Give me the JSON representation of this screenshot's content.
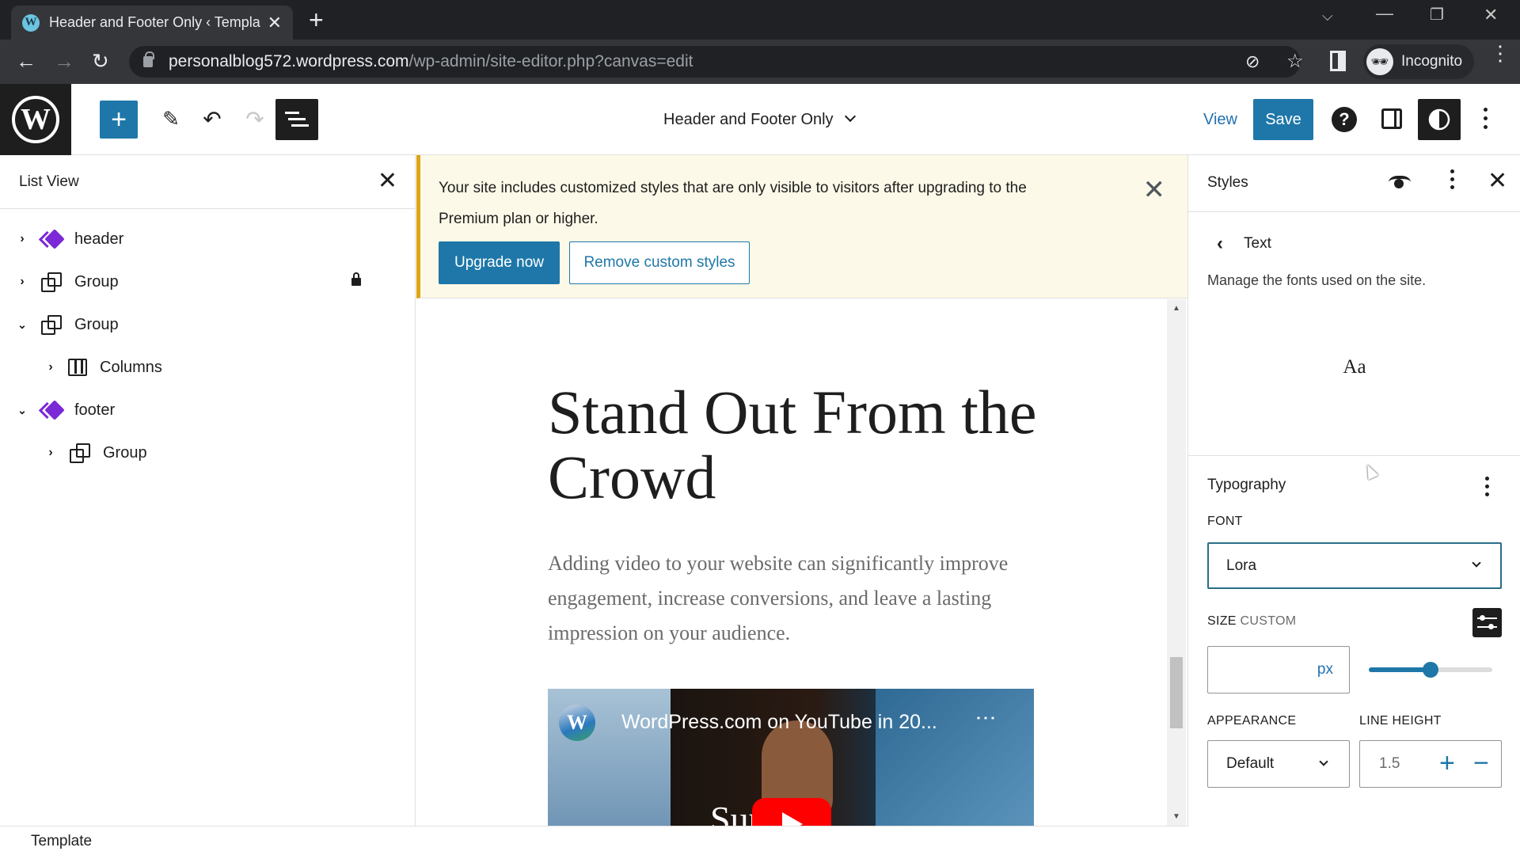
{
  "browser": {
    "tab_title": "Header and Footer Only ‹ Templa",
    "url_host": "personalblog572.wordpress.com",
    "url_path": "/wp-admin/site-editor.php?canvas=edit",
    "profile_label": "Incognito"
  },
  "toolbar": {
    "document_title": "Header and Footer Only",
    "view_label": "View",
    "save_label": "Save"
  },
  "list_view": {
    "title": "List View",
    "items": [
      {
        "label": "header",
        "icon": "template-part-icon",
        "expanded": false,
        "level": 0,
        "locked": false
      },
      {
        "label": "Group",
        "icon": "group-icon",
        "expanded": false,
        "level": 0,
        "locked": true
      },
      {
        "label": "Group",
        "icon": "group-icon",
        "expanded": true,
        "level": 0,
        "locked": false
      },
      {
        "label": "Columns",
        "icon": "columns-icon",
        "expanded": false,
        "level": 1,
        "locked": false
      },
      {
        "label": "footer",
        "icon": "template-part-icon",
        "expanded": true,
        "level": 0,
        "locked": false
      },
      {
        "label": "Group",
        "icon": "group-icon",
        "expanded": false,
        "level": 1,
        "locked": false
      }
    ]
  },
  "notice": {
    "message": "Your site includes customized styles that are only visible to visitors after upgrading to the Premium plan or higher.",
    "upgrade_label": "Upgrade now",
    "remove_label": "Remove custom styles",
    "accent_color": "#dba617"
  },
  "canvas": {
    "heading": "Stand Out From the Crowd",
    "paragraph": "Adding video to your website can significantly improve engagement, increase conversions, and leave a lasting impression on your audience.",
    "video_title": "WordPress.com on YouTube in 20...",
    "video_overlay_text": "Support"
  },
  "status_bar": {
    "breadcrumb": "Template"
  },
  "styles_panel": {
    "title": "Styles",
    "section": "Text",
    "description": "Manage the fonts used on the site.",
    "preview_text": "Aa",
    "typography": {
      "heading": "Typography",
      "font_label": "FONT",
      "font_value": "Lora",
      "size_label": "SIZE",
      "size_mode": "CUSTOM",
      "size_value": "",
      "size_unit": "px",
      "size_slider_fraction": 0.5,
      "appearance_label": "APPEARANCE",
      "appearance_value": "Default",
      "line_height_label": "LINE HEIGHT",
      "line_height_value": "1.5"
    }
  },
  "colors": {
    "wp_blue": "#1e77a8",
    "template_part_purple": "#7b28d6"
  }
}
